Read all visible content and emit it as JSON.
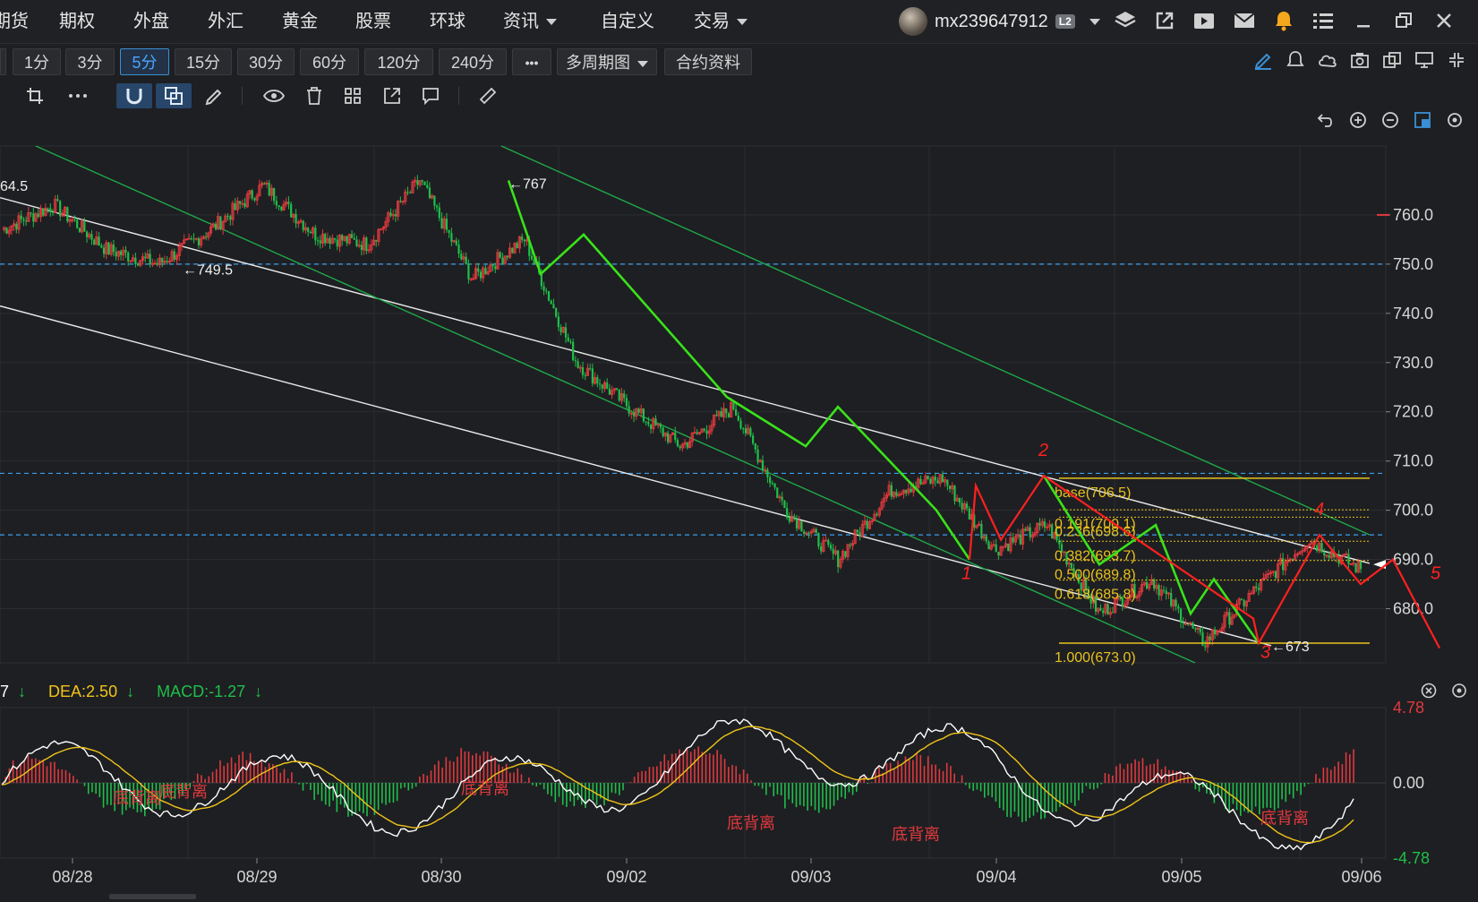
{
  "nav": {
    "items": [
      {
        "label": "期货"
      },
      {
        "label": "期权"
      },
      {
        "label": "外盘"
      },
      {
        "label": "外汇"
      },
      {
        "label": "黄金"
      },
      {
        "label": "股票"
      },
      {
        "label": "环球"
      },
      {
        "label": "资讯"
      },
      {
        "label": "自定义"
      },
      {
        "label": "交易"
      }
    ],
    "user": "mx239647912",
    "level_badge": "L2"
  },
  "periods": [
    "1分",
    "3分",
    "5分",
    "15分",
    "30分",
    "60分",
    "120分",
    "240分"
  ],
  "active_period": "5分",
  "more_label": "•••",
  "multi_period_label": "多周期图",
  "contract_label": "合约资料",
  "colors": {
    "background": "#1e1f22",
    "up": "#e0393e",
    "down": "#1fbf4a",
    "green_annotation": "#39e21a",
    "red_annotation": "#ff2020",
    "fib": "#e8c11d",
    "dashed": "#3a9ff0",
    "macd_dif": "#ffffff",
    "macd_dea": "#f0c419"
  },
  "chart_data": {
    "type": "candlestick",
    "price_axis": {
      "ticks": [
        "760.0",
        "750.0",
        "740.0",
        "730.0",
        "720.0",
        "710.0",
        "700.0",
        "690.0",
        "680.0"
      ],
      "ylim": [
        669,
        774
      ]
    },
    "x_axis": {
      "ticks": [
        "08/28",
        "08/29",
        "08/30",
        "09/02",
        "09/03",
        "09/04",
        "09/05",
        "09/06"
      ]
    },
    "price_labels": [
      {
        "text": "64.5",
        "value": 764.5
      },
      {
        "text": "←749.5",
        "value": 749.5
      },
      {
        "text": "←767",
        "value": 767
      },
      {
        "text": "←673",
        "value": 673
      }
    ],
    "fib_levels": [
      {
        "label": "base(706.5)",
        "value": 706.5
      },
      {
        "label": "0.191(700.1)",
        "value": 700.1
      },
      {
        "label": "0.236(698.6)",
        "value": 698.6
      },
      {
        "label": "0.382(693.7)",
        "value": 693.7
      },
      {
        "label": "0.500(689.8)",
        "value": 689.8
      },
      {
        "label": "0.618(685.8)",
        "value": 685.8
      },
      {
        "label": "1.000(673.0)",
        "value": 673.0
      }
    ],
    "dashed_levels": [
      750,
      707.5,
      695
    ],
    "approx_close_path": [
      {
        "day": "08/27",
        "value": 757
      },
      {
        "day": "08/28",
        "value": 762
      },
      {
        "day": "08/28",
        "value": 753
      },
      {
        "day": "08/29",
        "value": 750
      },
      {
        "day": "08/29",
        "value": 757
      },
      {
        "day": "08/29",
        "value": 766
      },
      {
        "day": "08/30",
        "value": 756
      },
      {
        "day": "08/30",
        "value": 754
      },
      {
        "day": "08/30",
        "value": 767
      },
      {
        "day": "09/02",
        "value": 747
      },
      {
        "day": "09/02",
        "value": 755
      },
      {
        "day": "09/02",
        "value": 730
      },
      {
        "day": "09/03",
        "value": 721
      },
      {
        "day": "09/03",
        "value": 713
      },
      {
        "day": "09/03",
        "value": 721
      },
      {
        "day": "09/04",
        "value": 700
      },
      {
        "day": "09/04",
        "value": 690
      },
      {
        "day": "09/04",
        "value": 704
      },
      {
        "day": "09/04",
        "value": 706.5
      },
      {
        "day": "09/05",
        "value": 692
      },
      {
        "day": "09/05",
        "value": 697
      },
      {
        "day": "09/05",
        "value": 679
      },
      {
        "day": "09/05",
        "value": 686
      },
      {
        "day": "09/05",
        "value": 673
      },
      {
        "day": "09/06",
        "value": 684
      },
      {
        "day": "09/06",
        "value": 694
      },
      {
        "day": "09/06",
        "value": 688
      }
    ],
    "green_wave": [
      767,
      748,
      756,
      723,
      713,
      721,
      700,
      690
    ],
    "green_wave_2": [
      707,
      689,
      697,
      679,
      686,
      673
    ],
    "red_wave": [
      700,
      705,
      694,
      707,
      696,
      673,
      695,
      685,
      690,
      677
    ],
    "wave_labels": [
      "1",
      "2",
      "3",
      "4",
      "5"
    ],
    "macd": {
      "legend": [
        {
          "text": "7",
          "arrow": "↓",
          "color": "white"
        },
        {
          "text": "DEA:2.50",
          "arrow": "↓",
          "color": "yellow"
        },
        {
          "text": "MACD:-1.27",
          "arrow": "↓",
          "color": "green"
        }
      ],
      "axis_ticks": [
        "4.78",
        "0.00",
        "-4.78"
      ],
      "ylim": [
        -4.78,
        4.78
      ],
      "annotations": [
        "底背离",
        "底背离",
        "底背离",
        "底背离",
        "底背离",
        "底背离"
      ]
    }
  }
}
